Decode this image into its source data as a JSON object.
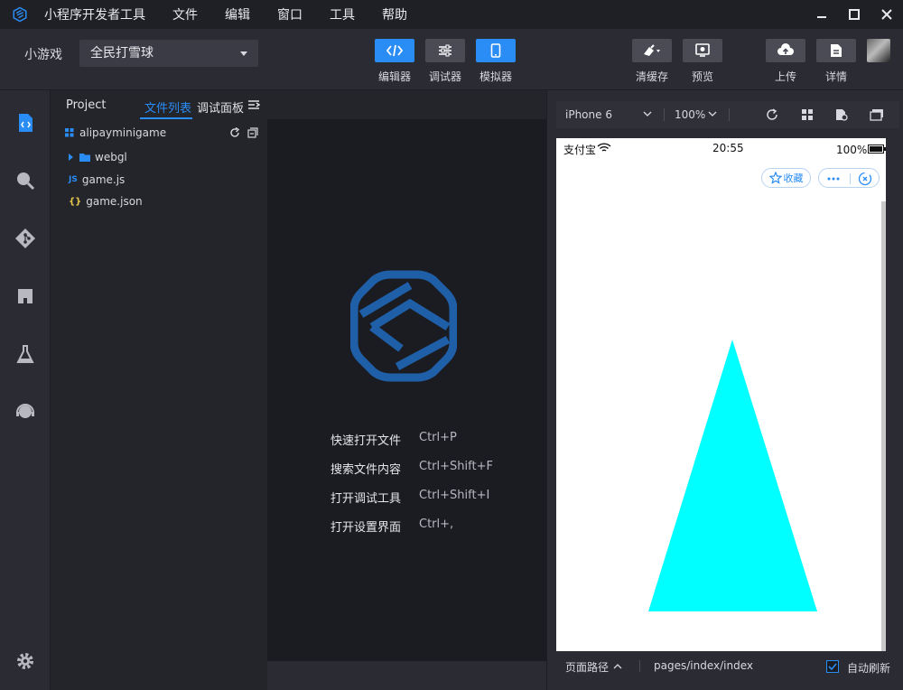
{
  "app": {
    "name": "小程序开发者工具",
    "menu": [
      "文件",
      "编辑",
      "窗口",
      "工具",
      "帮助"
    ]
  },
  "toolbar": {
    "mode_label": "小游戏",
    "project": "全民打雪球",
    "buttons": [
      {
        "label": "编辑器",
        "active": true
      },
      {
        "label": "调试器",
        "active": false
      },
      {
        "label": "模拟器",
        "active": true
      }
    ],
    "right_buttons": [
      "清缓存",
      "预览",
      "上传",
      "详情"
    ]
  },
  "explorer": {
    "tabs": [
      "Project",
      "文件列表",
      "调试面板"
    ],
    "active_tab": "文件列表",
    "root": "alipayminigame",
    "items": [
      {
        "name": "webgl",
        "type": "folder"
      },
      {
        "name": "game.js",
        "type": "js"
      },
      {
        "name": "game.json",
        "type": "json"
      }
    ]
  },
  "editor": {
    "shortcuts": [
      {
        "label": "快速打开文件",
        "keys": "Ctrl+P"
      },
      {
        "label": "搜索文件内容",
        "keys": "Ctrl+Shift+F"
      },
      {
        "label": "打开调试工具",
        "keys": "Ctrl+Shift+I"
      },
      {
        "label": "打开设置界面",
        "keys": "Ctrl+,"
      }
    ]
  },
  "simulator": {
    "device": "iPhone 6",
    "zoom": "100%",
    "status": {
      "carrier": "支付宝",
      "time": "20:55",
      "battery": "100%"
    },
    "favorite_label": "收藏",
    "triangle_color": "#00ffff",
    "page_path_label": "页面路径",
    "page_path": "pages/index/index",
    "auto_refresh_label": "自动刷新",
    "auto_refresh": true
  },
  "colors": {
    "accent": "#2a8cf5",
    "logo": "#1f5fa8"
  }
}
